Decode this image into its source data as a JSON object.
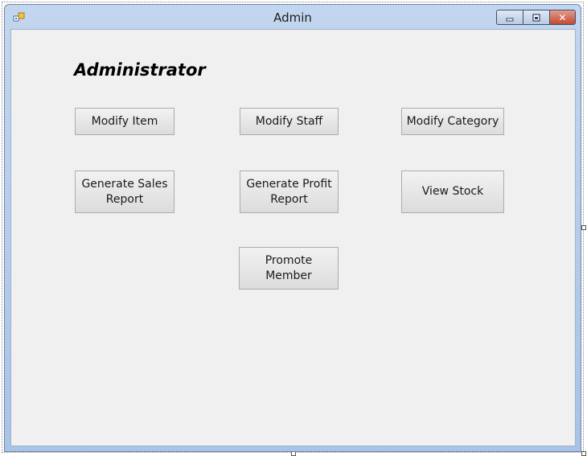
{
  "window": {
    "title": "Admin",
    "controls": {
      "minimize_icon": "minimize-icon",
      "maximize_icon": "maximize-icon",
      "close_icon": "close-icon",
      "close_glyph": "✕"
    }
  },
  "form": {
    "heading": "Administrator",
    "buttons": {
      "modify_item": "Modify Item",
      "modify_staff": "Modify Staff",
      "modify_category": "Modify Category",
      "generate_sales_report": "Generate Sales\nReport",
      "generate_profit_report": "Generate Profit\nReport",
      "view_stock": "View Stock",
      "promote_member": "Promote\nMember"
    }
  },
  "colors": {
    "titlebar": "#bcd1ee",
    "client_background": "#f0f0f0",
    "close_button": "#c85a45"
  }
}
